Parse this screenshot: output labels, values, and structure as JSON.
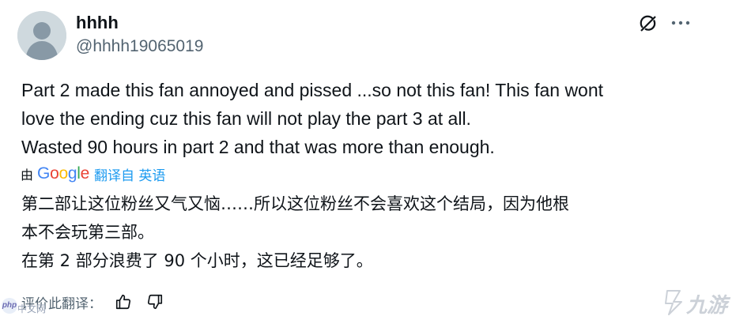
{
  "tweet": {
    "author_name": "hhhh",
    "author_handle": "@hhhh19065019",
    "body_lines": [
      "Part 2 made this fan annoyed and pissed ...so not this fan! This fan wont",
      "love the ending cuz this fan will not play the part 3 at all.",
      "Wasted 90 hours in part 2 and that was more than enough."
    ],
    "translated_by_prefix": "由",
    "translation_provider": "Google",
    "translated_from_label": "翻译自 英语",
    "translated_lines": [
      "第二部让这位粉丝又气又恼……所以这位粉丝不会喜欢这个结局，因为他根",
      "本不会玩第三部。",
      "在第 2 部分浪费了 90 个小时，这已经足够了。"
    ],
    "rate_translation_label": "评价此翻译："
  },
  "icons": {
    "grok": "grok-icon",
    "more": "more-icon",
    "thumbs_up": "thumbs-up-icon",
    "thumbs_down": "thumbs-down-icon"
  },
  "watermarks": {
    "left_logo": "php",
    "left_text": "中文网",
    "right_text": "九游"
  },
  "colors": {
    "text_primary": "#0f1419",
    "text_secondary": "#536471",
    "link_blue": "#1d9bf0",
    "google_blue": "#4285F4",
    "google_red": "#EA4335",
    "google_yellow": "#FBBC05",
    "google_green": "#34A853"
  }
}
